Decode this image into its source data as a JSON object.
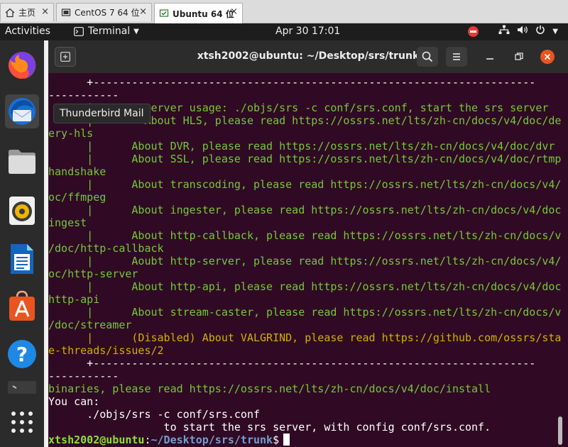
{
  "vm_tabs": [
    {
      "label": "主页"
    },
    {
      "label": "CentOS 7 64 位"
    },
    {
      "label": "Ubuntu 64 位"
    }
  ],
  "topbar": {
    "activities": "Activities",
    "app_menu": "Terminal",
    "clock": "Apr 30  17:01"
  },
  "dock": {
    "tooltip": "Thunderbird Mail"
  },
  "terminal": {
    "title": "xtsh2002@ubuntu: ~/Desktop/srs/trunk",
    "lines": [
      {
        "text": "      +---------------------------------------------------------------------",
        "color": "white"
      },
      {
        "text": "-----------",
        "color": "white"
      },
      {
        "text": "      |        server usage: ./objs/srs -c conf/srs.conf, start the srs server",
        "color": "green"
      },
      {
        "text": "      |        About HLS, please read https://ossrs.net/lts/zh-cn/docs/v4/doc/deliv",
        "color": "green"
      },
      {
        "text": "ery-hls",
        "color": "green"
      },
      {
        "text": "      |      About DVR, please read https://ossrs.net/lts/zh-cn/docs/v4/doc/dvr",
        "color": "green"
      },
      {
        "text": "      |      About SSL, please read https://ossrs.net/lts/zh-cn/docs/v4/doc/rtmp-",
        "color": "green"
      },
      {
        "text": "handshake",
        "color": "green"
      },
      {
        "text": "      |      About transcoding, please read https://ossrs.net/lts/zh-cn/docs/v4/d",
        "color": "green"
      },
      {
        "text": "oc/ffmpeg",
        "color": "green"
      },
      {
        "text": "      |      About ingester, please read https://ossrs.net/lts/zh-cn/docs/v4/doc/",
        "color": "green"
      },
      {
        "text": "ingest",
        "color": "green"
      },
      {
        "text": "      |      About http-callback, please read https://ossrs.net/lts/zh-cn/docs/v4",
        "color": "green"
      },
      {
        "text": "/doc/http-callback",
        "color": "green"
      },
      {
        "text": "      |      Aoubt http-server, please read https://ossrs.net/lts/zh-cn/docs/v4/d",
        "color": "green"
      },
      {
        "text": "oc/http-server",
        "color": "green"
      },
      {
        "text": "      |      About http-api, please read https://ossrs.net/lts/zh-cn/docs/v4/doc/",
        "color": "green"
      },
      {
        "text": "http-api",
        "color": "green"
      },
      {
        "text": "      |      About stream-caster, please read https://ossrs.net/lts/zh-cn/docs/v4",
        "color": "green"
      },
      {
        "text": "/doc/streamer",
        "color": "green"
      },
      {
        "text": "      |      (Disabled) About VALGRIND, please read https://github.com/ossrs/stat",
        "color": "yellow"
      },
      {
        "text": "e-threads/issues/2",
        "color": "yellow"
      },
      {
        "text": "      +---------------------------------------------------------------------",
        "color": "white"
      },
      {
        "text": "-----------",
        "color": "white"
      },
      {
        "text": "binaries, please read https://ossrs.net/lts/zh-cn/docs/v4/doc/install",
        "color": "green"
      },
      {
        "text": "You can:",
        "color": "white"
      },
      {
        "text": "      ./objs/srs -c conf/srs.conf",
        "color": "white"
      },
      {
        "text": "                  to start the srs server, with config conf/srs.conf.",
        "color": "white"
      }
    ],
    "prompt": {
      "user": "xtsh2002@ubuntu",
      "sep": ":",
      "path": "~/Desktop/srs/trunk",
      "symbol": "$"
    }
  }
}
